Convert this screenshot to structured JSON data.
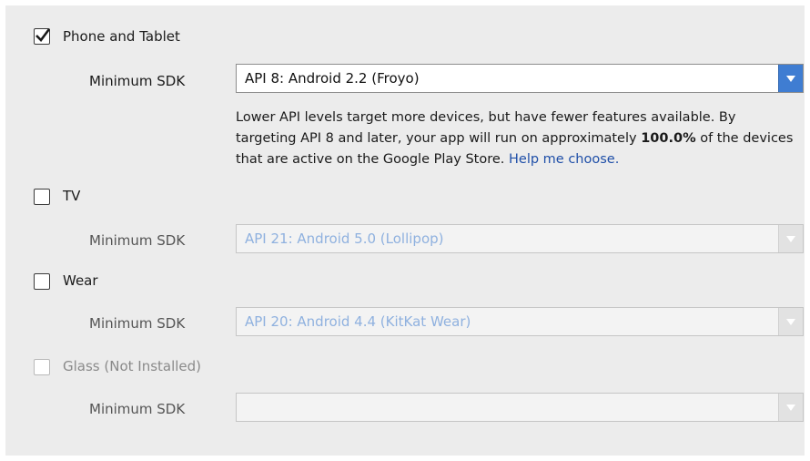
{
  "phone_tablet": {
    "label": "Phone and Tablet",
    "checked": true,
    "sdk_label": "Minimum SDK",
    "sdk_value": "API 8: Android 2.2 (Froyo)",
    "desc_part1": "Lower API levels target more devices, but have fewer features available. By targeting API 8 and later, your app will run on approximately ",
    "desc_percent": "100.0%",
    "desc_part2": " of the devices that are active on the Google Play Store. ",
    "help_link": "Help me choose."
  },
  "tv": {
    "label": "TV",
    "checked": false,
    "sdk_label": "Minimum SDK",
    "sdk_value": "API 21: Android 5.0 (Lollipop)"
  },
  "wear": {
    "label": "Wear",
    "checked": false,
    "sdk_label": "Minimum SDK",
    "sdk_value": "API 20: Android 4.4 (KitKat Wear)"
  },
  "glass": {
    "label": "Glass (Not Installed)",
    "checked": false,
    "sdk_label": "Minimum SDK",
    "sdk_value": ""
  },
  "colors": {
    "dropdown_accent": "#3f7dd2",
    "disabled_text": "#8fb1df",
    "link": "#1f4fa8"
  }
}
